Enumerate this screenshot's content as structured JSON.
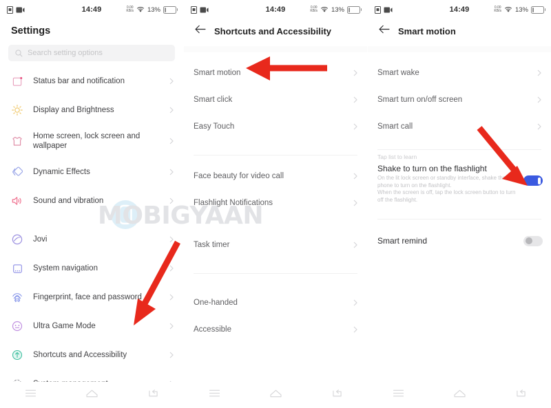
{
  "status_bar": {
    "time": "14:49",
    "net_speed_value": "0.00",
    "net_speed_unit": "KB/s",
    "battery_percent": "13%",
    "icons": [
      "sim-card-icon",
      "screen-recorder-icon",
      "network-speed-icon",
      "wifi-icon",
      "battery-icon"
    ]
  },
  "watermark": {
    "text": "MOBIGYAAN",
    "color": "#e2e3e6"
  },
  "colors": {
    "toggle_on": "#3b5ae0",
    "toggle_off": "#e6e6e8",
    "arrow_red": "#e8291c",
    "text_primary": "#2e2e31",
    "text_secondary": "#5e5e61",
    "text_muted": "#c3c3c6"
  },
  "navbar": {
    "items": [
      {
        "name": "recents-button",
        "icon": "menu-icon"
      },
      {
        "name": "home-button",
        "icon": "home-icon"
      },
      {
        "name": "back-button",
        "icon": "back-icon"
      }
    ]
  },
  "screen1": {
    "title": "Settings",
    "search": {
      "placeholder": "Search setting options",
      "icon": "search-icon"
    },
    "items": [
      {
        "label": "Status bar and notification",
        "icon": "status-bar-icon",
        "icon_color": "#e8a0bd"
      },
      {
        "label": "Display and Brightness",
        "icon": "brightness-sun-icon",
        "icon_color": "#f0c86a"
      },
      {
        "label": "Home screen, lock screen and wallpaper",
        "icon": "wallpaper-icon",
        "icon_color": "#e08fa8"
      },
      {
        "label": "Dynamic Effects",
        "icon": "dynamic-effects-icon",
        "icon_color": "#9aa6e8"
      },
      {
        "label": "Sound and vibration",
        "icon": "speaker-icon",
        "icon_color": "#ef6f8e"
      }
    ],
    "items2": [
      {
        "label": "Jovi",
        "icon": "jovi-icon",
        "icon_color": "#9b8fe0"
      },
      {
        "label": "System navigation",
        "icon": "navigation-icon",
        "icon_color": "#8e8fe6"
      },
      {
        "label": "Fingerprint, face and password",
        "icon": "fingerprint-icon",
        "icon_color": "#7f8fe8"
      },
      {
        "label": "Ultra Game Mode",
        "icon": "game-mode-icon",
        "icon_color": "#c08fe0"
      },
      {
        "label": "Shortcuts and Accessibility",
        "icon": "accessibility-icon",
        "icon_color": "#3fbfa0"
      },
      {
        "label": "System management",
        "icon": "gear-icon",
        "icon_color": "#9a9a9e"
      }
    ]
  },
  "screen2": {
    "title": "Shortcuts and Accessibility",
    "back_icon": "back-arrow-icon",
    "group1": [
      {
        "label": "Smart motion"
      },
      {
        "label": "Smart click"
      },
      {
        "label": "Easy Touch"
      }
    ],
    "group2": [
      {
        "label": "Face beauty for video call"
      },
      {
        "label": "Flashlight Notifications"
      },
      {
        "label": "Task timer"
      }
    ],
    "group3": [
      {
        "label": "One-handed"
      },
      {
        "label": "Accessible"
      }
    ]
  },
  "screen3": {
    "title": "Smart motion",
    "back_icon": "back-arrow-icon",
    "group1": [
      {
        "label": "Smart wake"
      },
      {
        "label": "Smart turn on/off screen"
      },
      {
        "label": "Smart call"
      }
    ],
    "hint": "Tap list to learn",
    "flashlight": {
      "title": "Shake to turn on the flashlight",
      "description": "On the lit lock screen or standby interface, shake the phone to turn on the flashlight.\nWhen the screen is off, tap the lock screen button to turn off the flashlight.",
      "toggle_state": "on"
    },
    "smart_remind": {
      "title": "Smart remind",
      "toggle_state": "off"
    }
  },
  "annotations": [
    {
      "name": "arrow-to-shortcuts-and-accessibility",
      "target": "Shortcuts and Accessibility"
    },
    {
      "name": "arrow-to-smart-motion",
      "target": "Smart motion"
    },
    {
      "name": "arrow-to-flashlight-toggle",
      "target": "Shake to turn on the flashlight toggle"
    }
  ]
}
